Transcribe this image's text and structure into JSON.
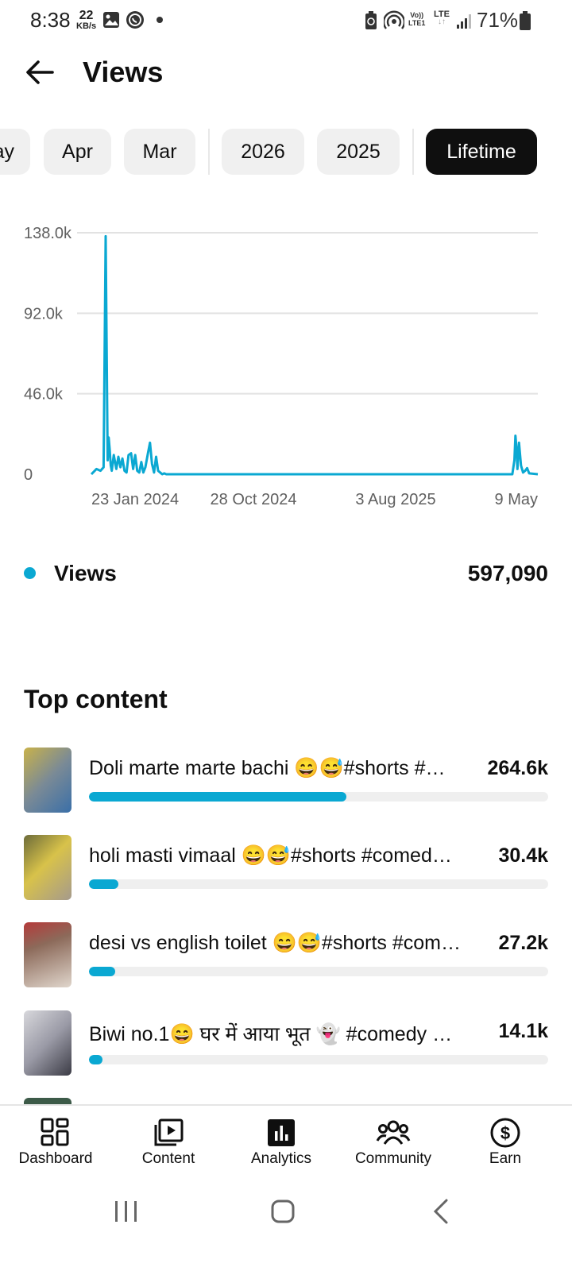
{
  "status_bar": {
    "time": "8:38",
    "speed_value": "22",
    "speed_unit": "KB/s",
    "volte": "Vo))",
    "volte_sub": "LTE1",
    "lte": "LTE",
    "battery_percent": "71%"
  },
  "header": {
    "title": "Views"
  },
  "filters": {
    "chips": [
      "ay",
      "Apr",
      "Mar",
      "2026",
      "2025",
      "Lifetime"
    ],
    "selected": "Lifetime"
  },
  "chart_data": {
    "type": "line",
    "title": "",
    "y_ticks": [
      "138.0k",
      "92.0k",
      "46.0k",
      "0"
    ],
    "x_ticks": [
      "23 Jan 2024",
      "28 Oct 2024",
      "3 Aug 2025",
      "9 May"
    ],
    "ylim": [
      0,
      138000
    ],
    "grid": true,
    "color": "#0aa8d2",
    "series": [
      {
        "name": "Views",
        "x": [
          "2023-12-15",
          "2023-12-25",
          "2024-01-02",
          "2024-01-08",
          "2024-01-12",
          "2024-01-16",
          "2024-01-18",
          "2024-01-20",
          "2024-01-22",
          "2024-01-24",
          "2024-01-28",
          "2024-02-02",
          "2024-02-06",
          "2024-02-10",
          "2024-02-14",
          "2024-02-18",
          "2024-02-22",
          "2024-02-26",
          "2024-03-02",
          "2024-03-06",
          "2024-03-10",
          "2024-03-14",
          "2024-03-18",
          "2024-03-22",
          "2024-03-26",
          "2024-03-30",
          "2024-04-04",
          "2024-04-08",
          "2024-04-12",
          "2024-04-16",
          "2024-04-20",
          "2024-04-24",
          "2024-04-28",
          "2024-05-02",
          "2024-05-06",
          "2024-05-10",
          "2024-05-14",
          "2024-05-18",
          "2024-05-22",
          "2024-05-26",
          "2024-06-01",
          "2024-06-15",
          "2024-07-01",
          "2024-08-01",
          "2024-10-28",
          "2025-01-01",
          "2025-04-01",
          "2025-08-03",
          "2025-12-01",
          "2026-02-20",
          "2026-03-10",
          "2026-03-20",
          "2026-03-24",
          "2026-03-26",
          "2026-03-28",
          "2026-03-30",
          "2026-04-02",
          "2026-04-06",
          "2026-04-10",
          "2026-04-14",
          "2026-04-18",
          "2026-04-22",
          "2026-05-09"
        ],
        "y": [
          0,
          3000,
          2000,
          4000,
          136000,
          8000,
          21000,
          14000,
          5000,
          2000,
          11000,
          3000,
          10000,
          4000,
          9000,
          2000,
          1000,
          11000,
          12000,
          3000,
          11000,
          2000,
          1000,
          7000,
          1000,
          4000,
          12000,
          18000,
          6000,
          1000,
          10000,
          2000,
          1000,
          0,
          500,
          0,
          0,
          0,
          0,
          0,
          0,
          0,
          0,
          0,
          0,
          0,
          0,
          0,
          0,
          0,
          0,
          0,
          8000,
          22000,
          15000,
          3000,
          18000,
          5000,
          1000,
          2000,
          3500,
          500,
          0
        ]
      }
    ]
  },
  "legend": {
    "label": "Views",
    "value": "597,090"
  },
  "top_content": {
    "title": "Top content",
    "max_views": 264600,
    "items": [
      {
        "title": "Doli marte marte bachi 😄😅#shorts #…",
        "views": "264.6k",
        "value": 264600,
        "thumb_colors": [
          "#7a8a96",
          "#c9b24a",
          "#3a6fa8"
        ]
      },
      {
        "title": "holi masti vimaal 😄😅#shorts #comed…",
        "views": "30.4k",
        "value": 30400,
        "thumb_colors": [
          "#6c6b3a",
          "#d8c24a",
          "#a59a8c"
        ]
      },
      {
        "title": "desi vs english toilet 😄😅#shorts #com…",
        "views": "27.2k",
        "value": 27200,
        "thumb_colors": [
          "#8c6a5a",
          "#e0d6cc",
          "#b53a3a"
        ]
      },
      {
        "title": "Biwi no.1😄 घर में आया भूत 👻 #comedy #…",
        "views": "14.1k",
        "value": 14100,
        "thumb_colors": [
          "#d8d8dc",
          "#3b3b45",
          "#9a9aa6"
        ]
      }
    ]
  },
  "bottom_nav": {
    "items": [
      {
        "label": "Dashboard",
        "icon": "dashboard-icon"
      },
      {
        "label": "Content",
        "icon": "content-icon"
      },
      {
        "label": "Analytics",
        "icon": "analytics-icon"
      },
      {
        "label": "Community",
        "icon": "community-icon"
      },
      {
        "label": "Earn",
        "icon": "earn-icon"
      }
    ],
    "active": "Analytics"
  }
}
